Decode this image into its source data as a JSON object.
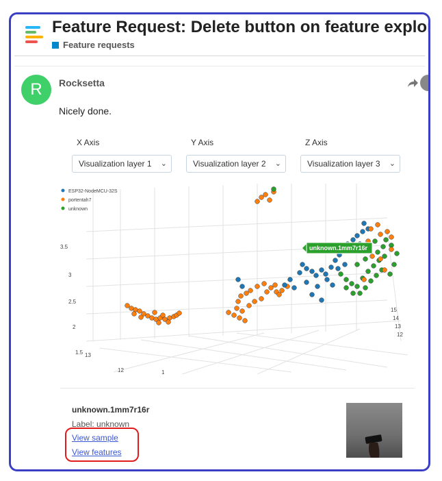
{
  "topic": {
    "title": "Feature Request: Delete button on feature explorer",
    "category": "Feature requests",
    "category_color": "#0088cc"
  },
  "post": {
    "avatar_letter": "R",
    "avatar_color": "#3fd06a",
    "username": "Rocksetta",
    "text": "Nicely done."
  },
  "explorer": {
    "axes": [
      {
        "label": "X Axis",
        "value": "Visualization layer 1"
      },
      {
        "label": "Y Axis",
        "value": "Visualization layer 2"
      },
      {
        "label": "Z Axis",
        "value": "Visualization layer 3"
      }
    ],
    "legend": [
      {
        "label": "ESP32-NodeMCU-32S",
        "color": "#1f77b4"
      },
      {
        "label": "portentah7",
        "color": "#ff7f0e"
      },
      {
        "label": "unknown",
        "color": "#2ca02c"
      }
    ],
    "z_ticks": [
      "3.5",
      "3",
      "2.5",
      "2",
      "1.5"
    ],
    "x_ticks": [
      "13",
      "12",
      "1"
    ],
    "y_ticks": [
      "15",
      "14",
      "13",
      "12"
    ],
    "tooltip": "unknown.1mm7r16r"
  },
  "sample": {
    "name": "unknown.1mm7r16r",
    "label": "Label: unknown",
    "view_sample": "View sample",
    "view_features": "View features"
  }
}
